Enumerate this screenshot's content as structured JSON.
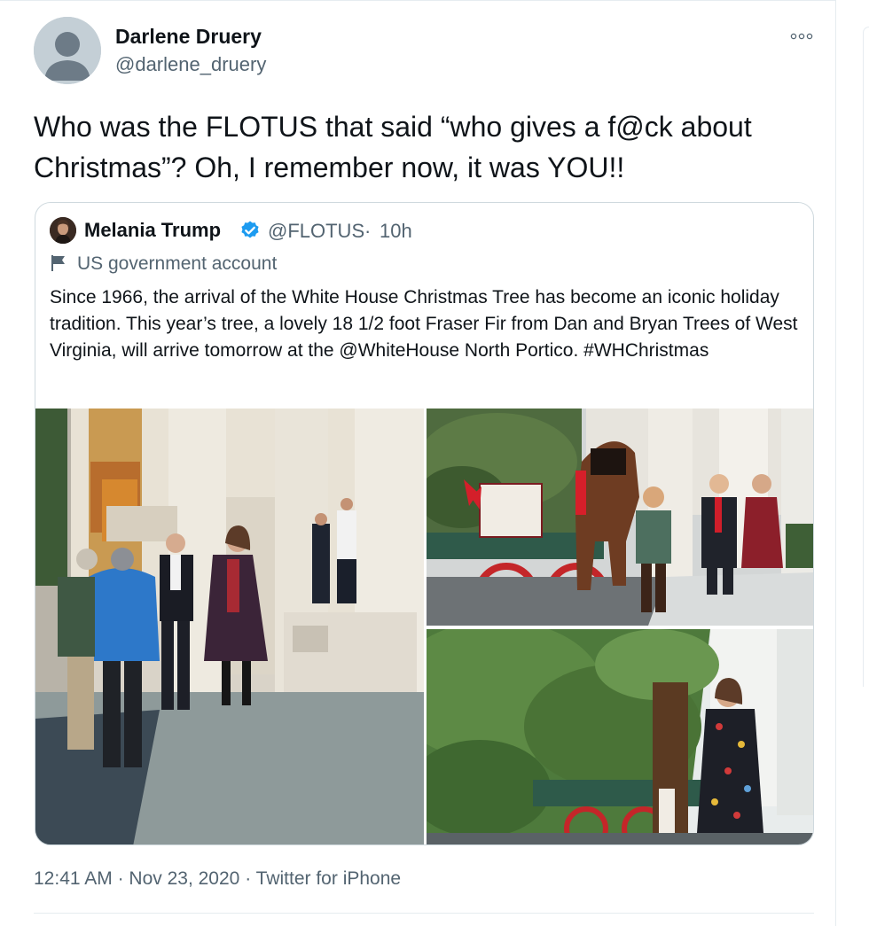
{
  "tweet": {
    "author": {
      "name": "Darlene Druery",
      "handle": "@darlene_druery",
      "avatar_icon": "default-profile-icon"
    },
    "more_icon": "more-options-icon",
    "text": "Who was the FLOTUS that said “who gives a f@ck about Christmas”? Oh, I remember now, it was YOU!!",
    "timestamp": "12:41 AM",
    "separator": "·",
    "date": "Nov 23, 2020",
    "source": "Twitter for iPhone"
  },
  "quoted_tweet": {
    "author": {
      "name": "Melania Trump",
      "handle": "@FLOTUS",
      "verified_icon": "verified-badge-icon",
      "verified_color": "#1d9bf0"
    },
    "separator": "·",
    "time_ago": "10h",
    "label_icon": "flag-icon",
    "label": "US government account",
    "text": "Since 1966, the arrival of the White House Christmas Tree has become an iconic holiday tradition. This year’s tree, a lovely 18 1/2 foot Fraser Fir from Dan and Bryan Trees of West Virginia, will arrive tomorrow at the @WhiteHouse North Portico. #WHChristmas",
    "media": [
      {
        "name": "photo-north-portico-group"
      },
      {
        "name": "photo-tree-wagon-horse"
      },
      {
        "name": "photo-tree-closeup"
      }
    ]
  },
  "colors": {
    "text_primary": "#0f1419",
    "text_secondary": "#536471",
    "border": "#cfd9de"
  }
}
